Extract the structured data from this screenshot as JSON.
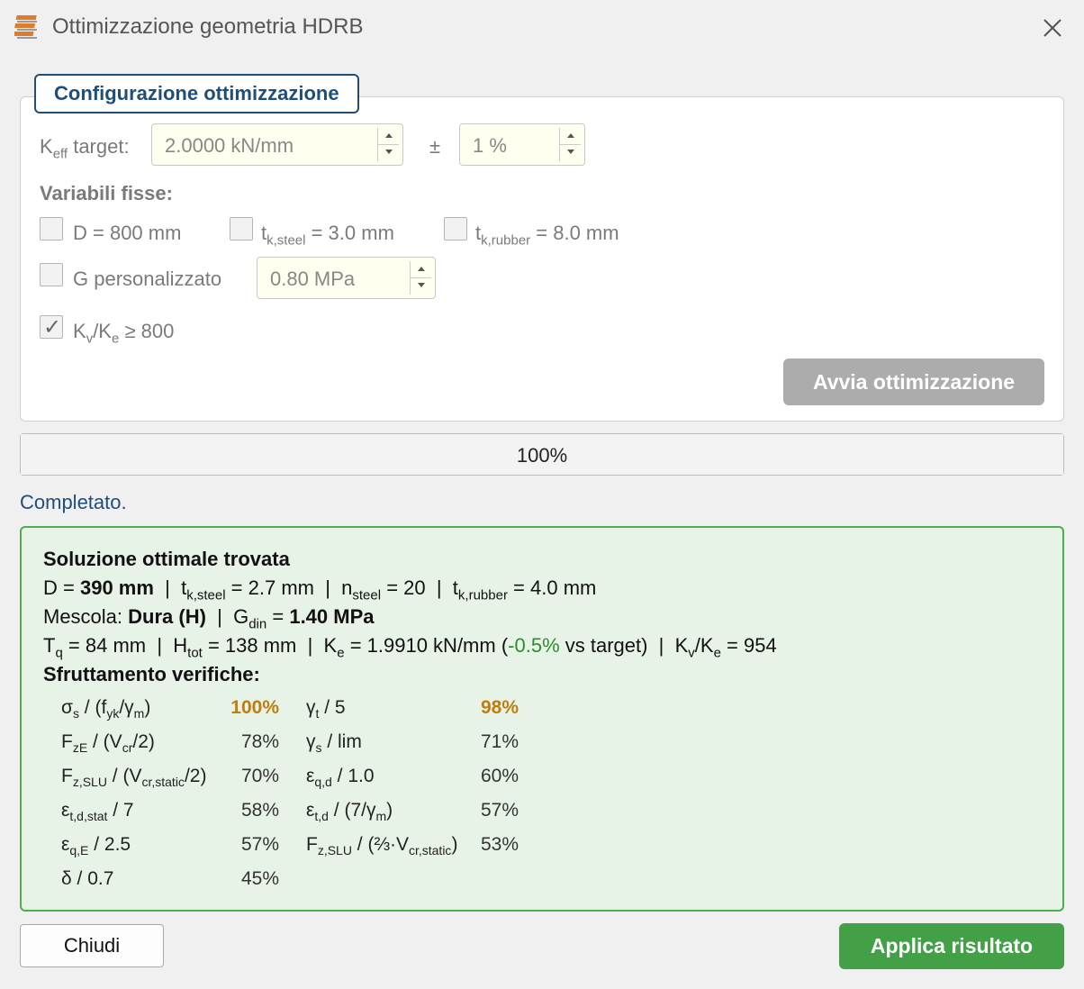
{
  "window": {
    "title": "Ottimizzazione geometria HDRB"
  },
  "config": {
    "group_title": "Configurazione ottimizzazione",
    "keff_label_main": "K",
    "keff_label_sub": "eff",
    "keff_label_tail": " target:",
    "keff_value": "2.0000 kN/mm",
    "tolerance_symbol": "±",
    "tolerance_value": "1 %",
    "fixed_vars_label": "Variabili fisse:",
    "fix_d_label": "D = 800 mm",
    "fix_d_checked": false,
    "fix_tsteel_main": "t",
    "fix_tsteel_sub": "k,steel",
    "fix_tsteel_tail": " = 3.0 mm",
    "fix_tsteel_checked": false,
    "fix_trubber_main": "t",
    "fix_trubber_sub": "k,rubber",
    "fix_trubber_tail": " = 8.0 mm",
    "fix_trubber_checked": false,
    "custom_g_label": "G personalizzato",
    "custom_g_checked": false,
    "custom_g_value": "0.80 MPa",
    "kv_check_mark": "✓",
    "kv_label_k1": "K",
    "kv_label_sub1": "v",
    "kv_label_slash": "/K",
    "kv_label_sub2": "e",
    "kv_label_tail": " ≥ 800",
    "kv_checked": true,
    "run_button": "Avvia ottimizzazione"
  },
  "progress": {
    "fraction": 1.0,
    "text": "100%"
  },
  "status_text": "Completato.",
  "result": {
    "heading": "Soluzione ottimale trovata",
    "line1": {
      "d_label": "D = ",
      "d_value": "390 mm",
      "sep1": "  |  t",
      "tsteel_sub": "k,steel",
      "tsteel_tail": " = 2.7 mm  |  n",
      "nsteel_sub": "steel",
      "nsteel_tail": " = 20  |  t",
      "trubber_sub": "k,rubber",
      "trubber_tail": " = 4.0 mm"
    },
    "line2": {
      "mix_label": "Mescola: ",
      "mix_value": "Dura (H)",
      "sep": "  |  G",
      "gdin_sub": "din",
      "gdin_eq": " = ",
      "gdin_value": "1.40 MPa"
    },
    "line3": {
      "tq_main": "T",
      "tq_sub": "q",
      "tq_tail": " = 84 mm  |  H",
      "htot_sub": "tot",
      "htot_tail": " = 138 mm  |  K",
      "ke_sub": "e",
      "ke_tail": " = 1.9910 kN/mm (",
      "deviation": "-0.5%",
      "vs_target": " vs target)  |  K",
      "kv_sub": "v",
      "kv_slash": "/K",
      "kv_sub2": "e",
      "kv_tail": " = 954"
    },
    "util_heading": "Sfruttamento verifiche:",
    "util": {
      "r1c1_a": "σ",
      "r1c1_sa": "s",
      "r1c1_b": " / (f",
      "r1c1_sb": "yk",
      "r1c1_c": "/γ",
      "r1c1_sc": "m",
      "r1c1_d": ")",
      "r1v1": "100%",
      "r1c2_a": "γ",
      "r1c2_sa": "t",
      "r1c2_b": " / 5",
      "r1v2": "98%",
      "r2c1_a": "F",
      "r2c1_sa": "zE",
      "r2c1_b": " / (V",
      "r2c1_sb": "cr",
      "r2c1_c": "/2)",
      "r2v1": "78%",
      "r2c2_a": "γ",
      "r2c2_sa": "s",
      "r2c2_b": " / lim",
      "r2v2": "71%",
      "r3c1_a": "F",
      "r3c1_sa": "z,SLU",
      "r3c1_b": " / (V",
      "r3c1_sb": "cr,static",
      "r3c1_c": "/2)",
      "r3v1": "70%",
      "r3c2_a": "ε",
      "r3c2_sa": "q,d",
      "r3c2_b": " / 1.0",
      "r3v2": "60%",
      "r4c1_a": "ε",
      "r4c1_sa": "t,d,stat",
      "r4c1_b": " / 7",
      "r4v1": "58%",
      "r4c2_a": "ε",
      "r4c2_sa": "t,d",
      "r4c2_b": " / (7/γ",
      "r4c2_sb": "m",
      "r4c2_c": ")",
      "r4v2": "57%",
      "r5c1_a": "ε",
      "r5c1_sa": "q,E",
      "r5c1_b": " / 2.5",
      "r5v1": "57%",
      "r5c2_a": "F",
      "r5c2_sa": "z,SLU",
      "r5c2_b": " / (⅔·V",
      "r5c2_sb": "cr,static",
      "r5c2_c": ")",
      "r5v2": "53%",
      "r6c1": "δ / 0.7",
      "r6v1": "45%"
    }
  },
  "buttons": {
    "close": "Chiudi",
    "apply": "Applica risultato"
  },
  "colors": {
    "accent": "#1f4e79",
    "apply_green": "#43a047",
    "result_bg": "#e7f3e7",
    "highlight": "#c17d0b"
  }
}
